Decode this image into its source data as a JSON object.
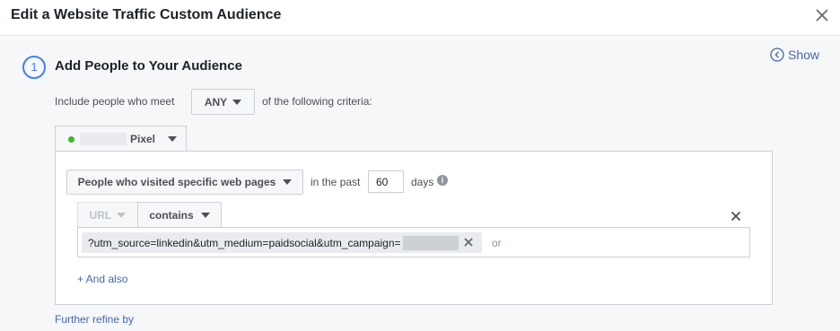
{
  "header": {
    "title": "Edit a Website Traffic Custom Audience"
  },
  "step": {
    "number": "1",
    "title": "Add People to Your Audience",
    "show_label": "Show"
  },
  "criteria": {
    "prefix": "Include people who meet",
    "match": "ANY",
    "suffix": "of the following criteria:"
  },
  "pixel": {
    "label": "Pixel"
  },
  "rule": {
    "event": "People who visited specific web pages",
    "in_the_past": "in the past",
    "days_value": "60",
    "days_label": "days",
    "field": "URL",
    "operator": "contains",
    "url_value": "?utm_source=linkedin&utm_medium=paidsocial&utm_campaign=",
    "or_label": "or",
    "and_also": "+ And also"
  },
  "further_refine": "Further refine by",
  "colors": {
    "link": "#4267b2",
    "step_accent": "#4080ff",
    "status_dot": "#42b72a"
  }
}
